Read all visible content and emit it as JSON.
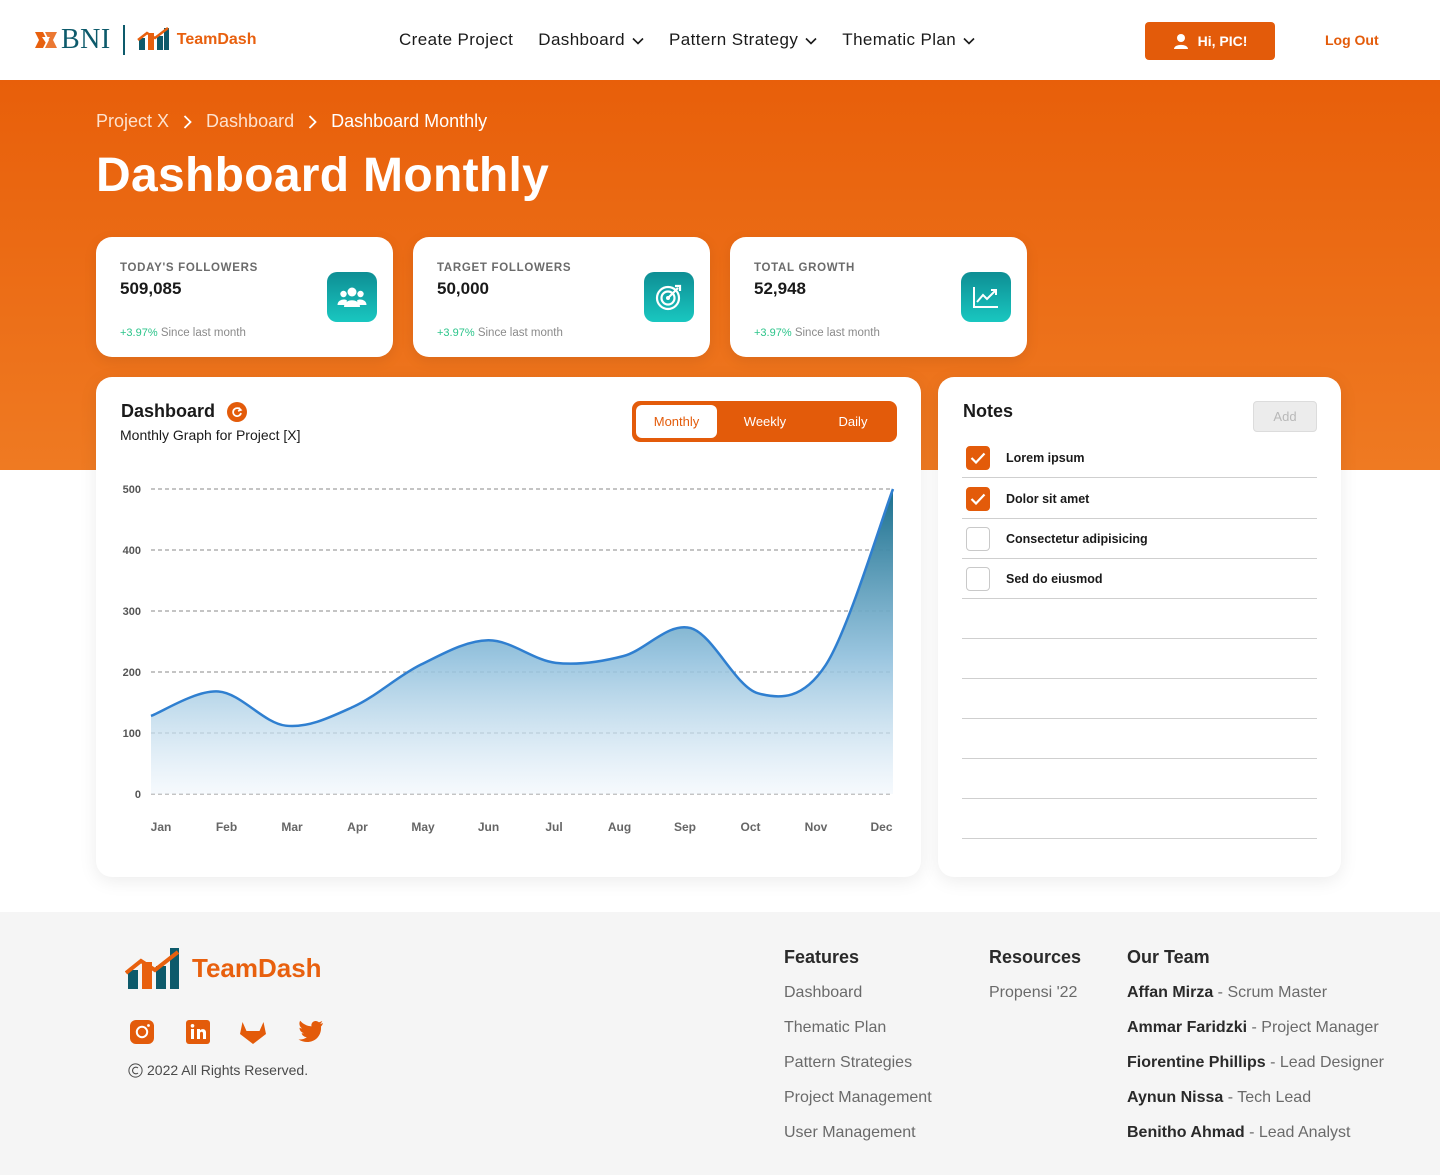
{
  "brand": {
    "bank": "BNI",
    "app": "TeamDash"
  },
  "nav": {
    "links": [
      "Create Project",
      "Dashboard",
      "Pattern Strategy",
      "Thematic Plan"
    ],
    "greeting": "Hi, PIC!",
    "logout": "Log Out"
  },
  "breadcrumb": [
    "Project X",
    "Dashboard",
    "Dashboard Monthly"
  ],
  "page_title": "Dashboard Monthly",
  "stats": [
    {
      "label": "TODAY'S FOLLOWERS",
      "value": "509,085",
      "delta": "+3.97%",
      "since": "Since last month",
      "icon": "users-icon"
    },
    {
      "label": "TARGET FOLLOWERS",
      "value": "50,000",
      "delta": "+3.97%",
      "since": "Since last month",
      "icon": "target-icon"
    },
    {
      "label": "TOTAL GROWTH",
      "value": "52,948",
      "delta": "+3.97%",
      "since": "Since last month",
      "icon": "growth-chart-icon"
    }
  ],
  "chart_card": {
    "title": "Dashboard",
    "subtitle": "Monthly Graph for Project [X]",
    "tabs": [
      "Monthly",
      "Weekly",
      "Daily"
    ],
    "active_tab": "Monthly"
  },
  "chart_data": {
    "type": "area",
    "categories": [
      "Jan",
      "Feb",
      "Mar",
      "Apr",
      "May",
      "Jun",
      "Jul",
      "Aug",
      "Sep",
      "Oct",
      "Nov",
      "Dec"
    ],
    "values": [
      128,
      168,
      112,
      143,
      212,
      252,
      215,
      226,
      272,
      165,
      211,
      500
    ],
    "ylim": [
      0,
      500
    ],
    "yticks": [
      0,
      100,
      200,
      300,
      400,
      500
    ],
    "grid": true,
    "line_color": "#2f7fd0",
    "fill_top": "#1a6f8c",
    "fill_bottom": "#f0f6fc"
  },
  "notes": {
    "title": "Notes",
    "add_label": "Add",
    "items": [
      {
        "text": "Lorem ipsum",
        "checked": true
      },
      {
        "text": "Dolor sit amet",
        "checked": true
      },
      {
        "text": "Consectetur adipisicing",
        "checked": false
      },
      {
        "text": "Sed do eiusmod",
        "checked": false
      }
    ]
  },
  "footer": {
    "brand": "TeamDash",
    "social": [
      "instagram-icon",
      "linkedin-icon",
      "gitlab-icon",
      "twitter-icon"
    ],
    "copyright": "2022 All Rights Reserved.",
    "features_title": "Features",
    "features": [
      "Dashboard",
      "Thematic Plan",
      "Pattern Strategies",
      "Project Management",
      "User Management"
    ],
    "resources_title": "Resources",
    "resources": [
      "Propensi '22"
    ],
    "team_title": "Our Team",
    "team": [
      {
        "name": "Affan Mirza",
        "role": "Scrum Master"
      },
      {
        "name": "Ammar Faridzki",
        "role": "Project Manager"
      },
      {
        "name": "Fiorentine Phillips",
        "role": "Lead Designer"
      },
      {
        "name": "Aynun Nissa",
        "role": "Tech Lead"
      },
      {
        "name": "Benitho Ahmad",
        "role": "Lead Analyst"
      }
    ]
  },
  "colors": {
    "accent": "#e35b0a",
    "teal": "#0e8e94",
    "positive": "#2bc48a"
  }
}
